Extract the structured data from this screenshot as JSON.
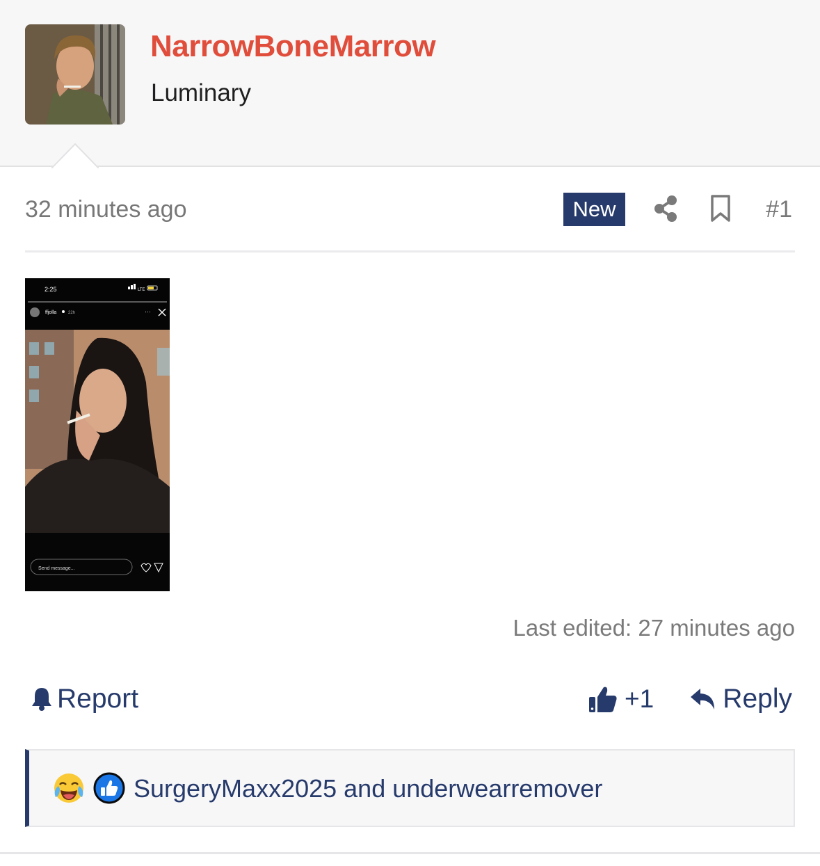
{
  "author": {
    "username": "NarrowBoneMarrow",
    "title": "Luminary",
    "avatar_icon": "portrait-avatar"
  },
  "post": {
    "time": "32 minutes ago",
    "badge": "New",
    "number": "#1",
    "last_edited": "Last edited: 27 minutes ago"
  },
  "attachment": {
    "clock": "2:25",
    "network": "LTE",
    "story_user": "ffjolla",
    "story_age": "22h",
    "message_placeholder": "Send message..."
  },
  "actions": {
    "report": "Report",
    "like_count": "+1",
    "reply": "Reply"
  },
  "reactions": {
    "icons": [
      "laughing-crying-emoji-icon",
      "thumbs-up-reaction-icon"
    ],
    "users": "SurgeryMaxx2025 and underwearremover"
  },
  "colors": {
    "accent": "#263a6b",
    "username": "#e04d3b"
  }
}
